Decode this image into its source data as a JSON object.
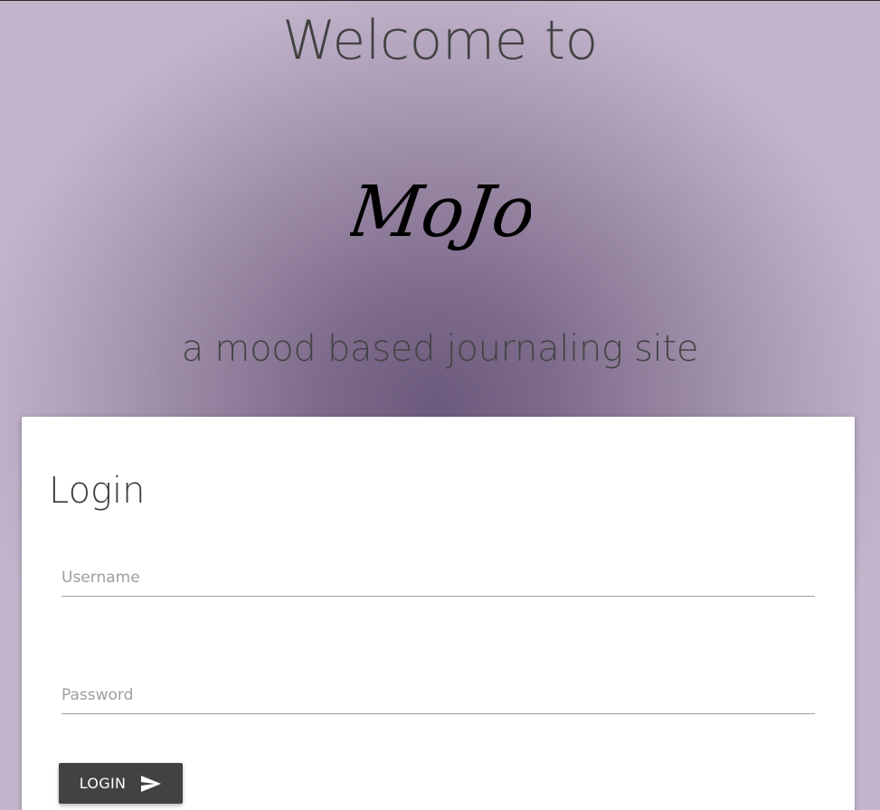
{
  "hero": {
    "title": "Welcome to",
    "logo_text": "MoJo",
    "tagline": "a mood based journaling site"
  },
  "login_card": {
    "title": "Login",
    "username": {
      "placeholder": "Username",
      "value": ""
    },
    "password": {
      "placeholder": "Password",
      "value": ""
    },
    "submit_label": "LOGIN",
    "submit_icon": "send-icon"
  },
  "colors": {
    "background_center": "#6c5a7c",
    "background_edge": "#c3b6cc",
    "text_dark": "#424242",
    "button_bg": "#424242",
    "button_text": "#ffffff",
    "card_bg": "#ffffff"
  }
}
